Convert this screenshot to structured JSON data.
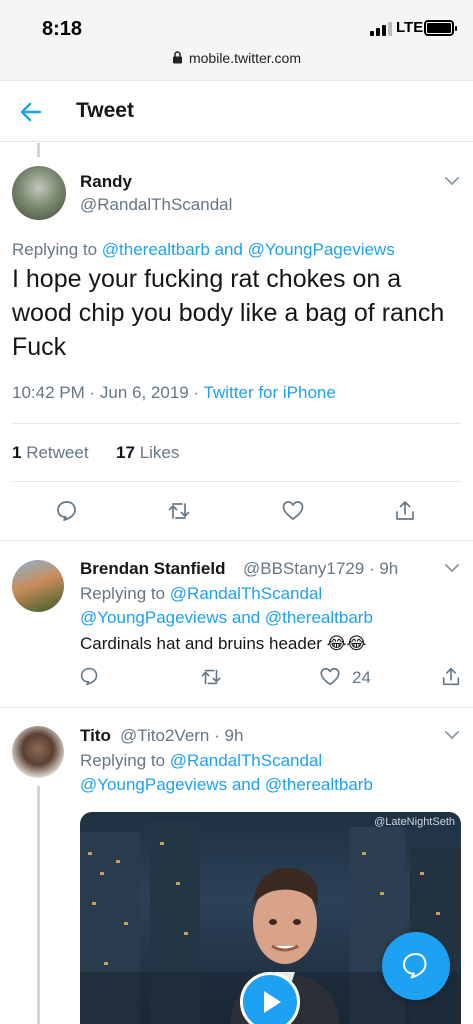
{
  "status_bar": {
    "time": "8:18",
    "network": "LTE",
    "url": "mobile.twitter.com"
  },
  "header": {
    "title": "Tweet"
  },
  "main_tweet": {
    "name": "Randy",
    "handle": "@RandalThScandal",
    "replying_label": "Replying to",
    "replying_user1": "@therealtbarb",
    "replying_and": "and",
    "replying_user2": "@YoungPageviews",
    "text": "I hope your fucking rat chokes on a wood chip you body like a bag of ranch Fuck",
    "time": "10:42 PM",
    "date": "Jun 6, 2019",
    "source": "Twitter for iPhone",
    "retweet_count": "1",
    "retweet_label": "Retweet",
    "likes_count": "17",
    "likes_label": "Likes"
  },
  "replies": [
    {
      "name": "Brendan Stanfield",
      "handle": "@BBStany1729",
      "age": "9h",
      "replying_label": "Replying to",
      "replying_user1": "@RandalThScandal",
      "replying_user2": "@YoungPageviews",
      "replying_and": "and",
      "replying_user3": "@therealtbarb",
      "text": "Cardinals hat and bruins header 😂😂",
      "like_count": "24"
    },
    {
      "name": "Tito",
      "handle": "@Tito2Vern",
      "age": "9h",
      "replying_label": "Replying to",
      "replying_user1": "@RandalThScandal",
      "replying_user2": "@YoungPageviews",
      "replying_and": "and",
      "replying_user3": "@therealtbarb",
      "media_watermark": "@LateNightSeth"
    }
  ],
  "colors": {
    "accent": "#1da1f2",
    "secondary_text": "#657786",
    "divider": "#e1e8ed"
  }
}
